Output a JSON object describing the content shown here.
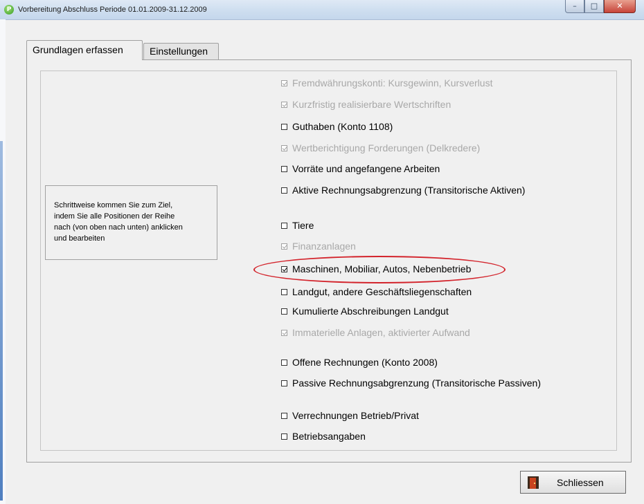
{
  "window": {
    "title": "Vorbereitung Abschluss Periode 01.01.2009-31.12.2009"
  },
  "tabs": [
    {
      "label": "Grundlagen erfassen",
      "active": true
    },
    {
      "label": "Einstellungen",
      "active": false
    }
  ],
  "hint": {
    "lines": [
      "Schrittweise kommen Sie zum Ziel,",
      "indem Sie alle Positionen der Reihe",
      "nach (von oben nach unten) anklicken",
      "und bearbeiten"
    ]
  },
  "items": [
    {
      "label": "Fremdwährungskonti: Kursgewinn, Kursverlust",
      "checked": true,
      "enabled": false
    },
    {
      "label": "Kurzfristig realisierbare Wertschriften",
      "checked": true,
      "enabled": false
    },
    {
      "label": "Guthaben (Konto 1108)",
      "checked": false,
      "enabled": true
    },
    {
      "label": "Wertberichtigung Forderungen (Delkredere)",
      "checked": true,
      "enabled": false
    },
    {
      "label": "Vorräte und angefangene Arbeiten",
      "checked": false,
      "enabled": true
    },
    {
      "label": "Aktive Rechnungsabgrenzung (Transitorische Aktiven)",
      "checked": false,
      "enabled": true
    },
    {
      "label": "Tiere",
      "checked": false,
      "enabled": true
    },
    {
      "label": "Finanzanlagen",
      "checked": true,
      "enabled": false
    },
    {
      "label": "Maschinen, Mobiliar, Autos, Nebenbetrieb",
      "checked": true,
      "enabled": true,
      "highlighted": true
    },
    {
      "label": "Landgut, andere Geschäftsliegenschaften",
      "checked": false,
      "enabled": true
    },
    {
      "label": "Kumulierte Abschreibungen Landgut",
      "checked": false,
      "enabled": true
    },
    {
      "label": "Immaterielle Anlagen, aktivierter Aufwand",
      "checked": true,
      "enabled": false
    },
    {
      "label": "Offene Rechnungen (Konto 2008)",
      "checked": false,
      "enabled": true
    },
    {
      "label": "Passive Rechnungsabgrenzung (Transitorische Passiven)",
      "checked": false,
      "enabled": true
    },
    {
      "label": "Verrechnungen Betrieb/Privat",
      "checked": false,
      "enabled": true
    },
    {
      "label": "Betriebsangaben",
      "checked": false,
      "enabled": true
    }
  ],
  "buttons": {
    "close_label": "Schliessen"
  },
  "colors": {
    "highlight_ellipse": "#d3232b",
    "disabled_text": "#a8a8a8"
  }
}
